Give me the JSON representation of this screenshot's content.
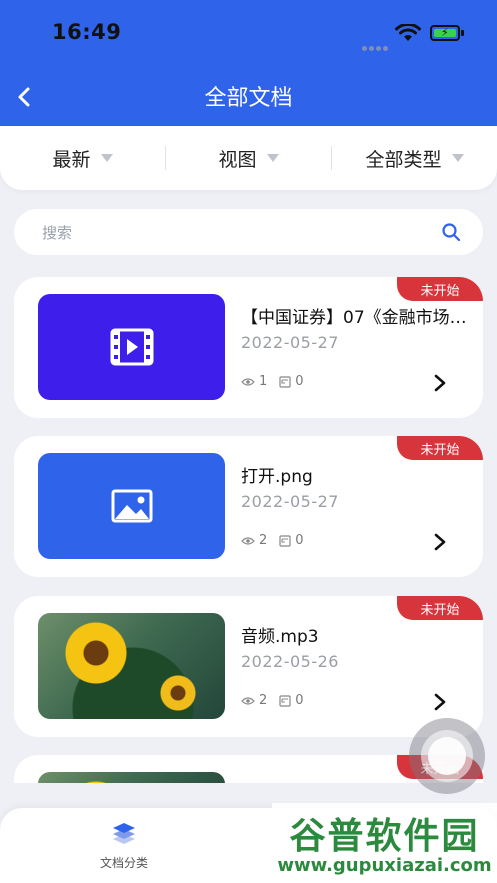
{
  "status_bar": {
    "time": "16:49"
  },
  "header": {
    "title": "全部文档"
  },
  "filters": [
    {
      "label": "最新"
    },
    {
      "label": "视图"
    },
    {
      "label": "全部类型"
    }
  ],
  "search": {
    "placeholder": "搜索",
    "value": ""
  },
  "documents": [
    {
      "title": "【中国证券】07《金融市场…",
      "date": "2022-05-27",
      "views": "1",
      "favorites": "0",
      "status": "未开始",
      "thumb": "video-icon"
    },
    {
      "title": "打开.png",
      "date": "2022-05-27",
      "views": "2",
      "favorites": "0",
      "status": "未开始",
      "thumb": "image-icon"
    },
    {
      "title": "音频.mp3",
      "date": "2022-05-26",
      "views": "2",
      "favorites": "0",
      "status": "未开始",
      "thumb": "sunflower-photo"
    },
    {
      "title": "",
      "date": "",
      "views": "",
      "favorites": "",
      "status": "未开始",
      "thumb": "sunflower-photo"
    }
  ],
  "bottom_nav": {
    "docs_label": "文档分类"
  },
  "watermark": {
    "title": "谷普软件园",
    "url": "www.gupuxiazai.com"
  },
  "colors": {
    "primary": "#2f63ea",
    "badge": "#d8343b",
    "video_thumb": "#3d1eea"
  }
}
